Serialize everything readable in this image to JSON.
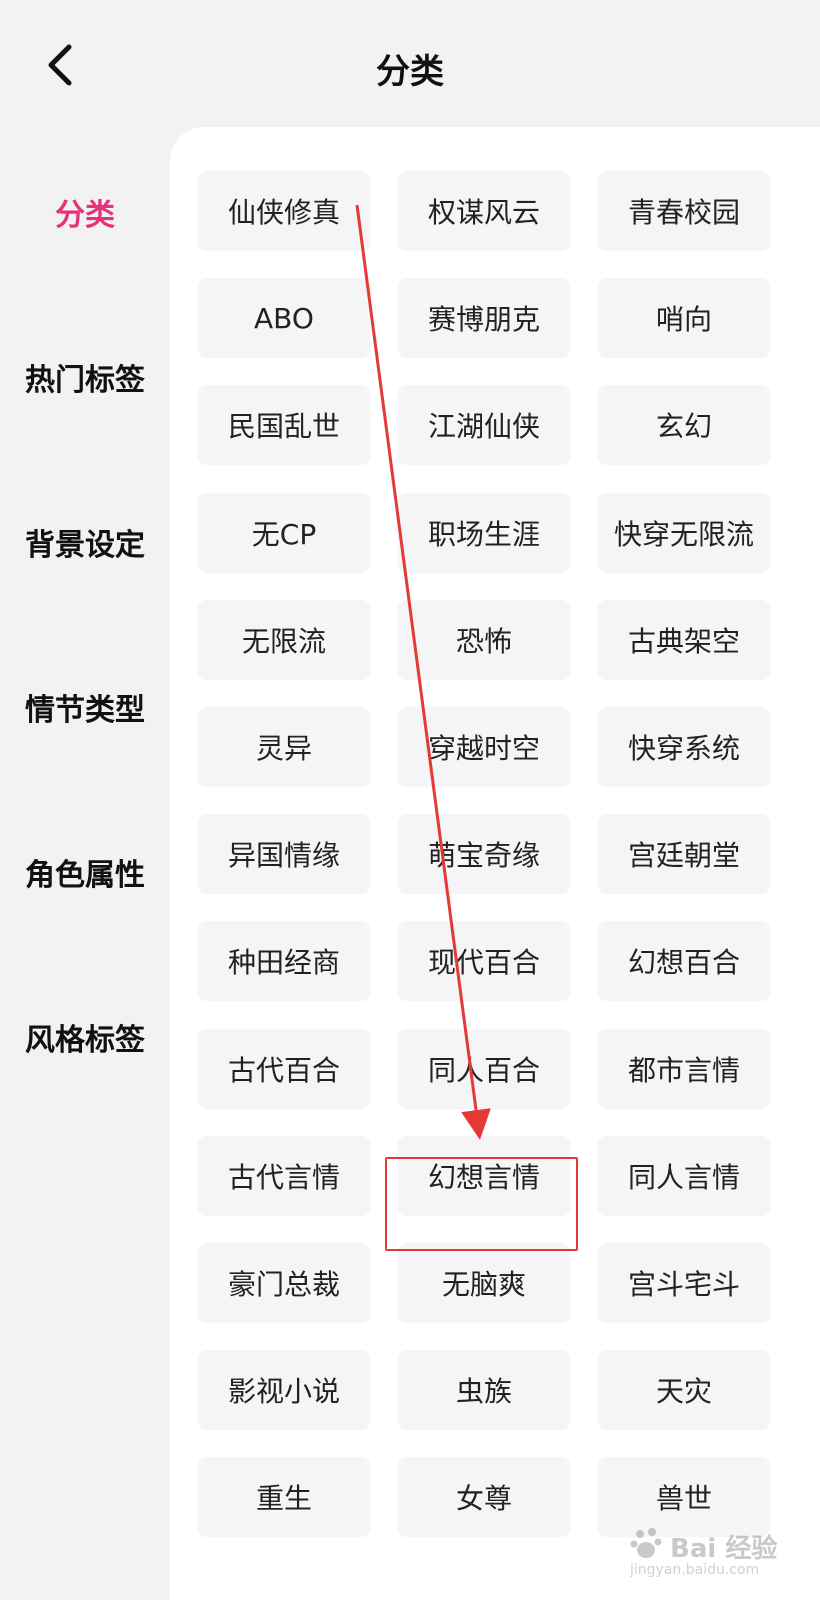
{
  "header": {
    "title": "分类",
    "back_icon": "chevron-left-icon"
  },
  "sidebar": {
    "items": [
      {
        "label": "分类",
        "active": true
      },
      {
        "label": "热门标签",
        "active": false
      },
      {
        "label": "背景设定",
        "active": false
      },
      {
        "label": "情节类型",
        "active": false
      },
      {
        "label": "角色属性",
        "active": false
      },
      {
        "label": "风格标签",
        "active": false
      }
    ]
  },
  "tags": [
    "仙侠修真",
    "权谋风云",
    "青春校园",
    "ABO",
    "赛博朋克",
    "哨向",
    "民国乱世",
    "江湖仙侠",
    "玄幻",
    "无CP",
    "职场生涯",
    "快穿无限流",
    "无限流",
    "恐怖",
    "古典架空",
    "灵异",
    "穿越时空",
    "快穿系统",
    "异国情缘",
    "萌宝奇缘",
    "宫廷朝堂",
    "种田经商",
    "现代百合",
    "幻想百合",
    "古代百合",
    "同人百合",
    "都市言情",
    "古代言情",
    "幻想言情",
    "同人言情",
    "豪门总裁",
    "无脑爽",
    "宫斗宅斗",
    "影视小说",
    "虫族",
    "天灾",
    "重生",
    "女尊",
    "兽世"
  ],
  "annotation": {
    "highlighted_tag": "幻想言情",
    "color": "#e53935"
  },
  "watermark": {
    "text": "Bai 经验",
    "sub": "jingyan.baidu.com"
  },
  "colors": {
    "accent": "#e8317a",
    "tag_bg": "#f5f5f7",
    "page_bg": "#f2f2f2"
  }
}
